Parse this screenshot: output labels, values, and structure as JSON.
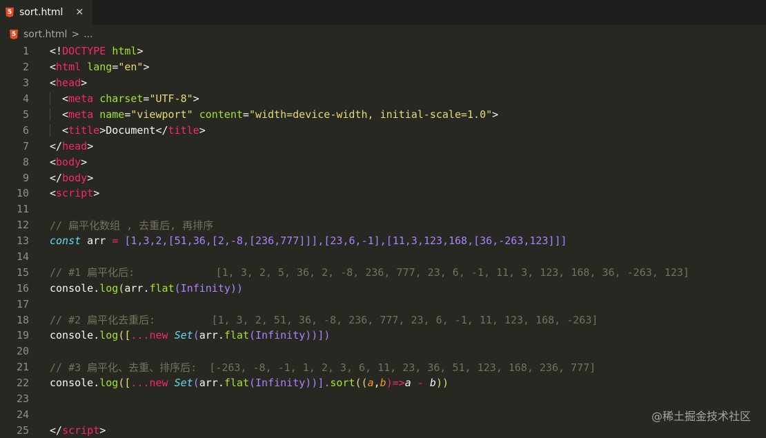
{
  "tab": {
    "label": "sort.html",
    "icon": "html5-icon",
    "close": "✕"
  },
  "breadcrumb": {
    "file": "sort.html",
    "sep": ">",
    "more": "..."
  },
  "lines": [
    "1",
    "2",
    "3",
    "4",
    "5",
    "6",
    "7",
    "8",
    "9",
    "10",
    "11",
    "12",
    "13",
    "14",
    "15",
    "16",
    "17",
    "18",
    "19",
    "20",
    "21",
    "22",
    "23",
    "24",
    "25"
  ],
  "code": {
    "l1": {
      "a": "<!",
      "b": "DOCTYPE",
      "c": " ",
      "d": "html",
      "e": ">"
    },
    "l2": {
      "a": "<",
      "b": "html",
      "c": " ",
      "d": "lang",
      "e": "=",
      "f": "\"en\"",
      "g": ">"
    },
    "l3": {
      "a": "<",
      "b": "head",
      "c": ">"
    },
    "l4": {
      "a": "<",
      "b": "meta",
      "c": " ",
      "d": "charset",
      "e": "=",
      "f": "\"UTF-8\"",
      "g": ">"
    },
    "l5": {
      "a": "<",
      "b": "meta",
      "c": " ",
      "d": "name",
      "e": "=",
      "f": "\"viewport\"",
      "g": " ",
      "h": "content",
      "i": "=",
      "j": "\"width=device-width, initial-scale=1.0\"",
      "k": ">"
    },
    "l6": {
      "a": "<",
      "b": "title",
      "c": ">Document</",
      "d": "title",
      "e": ">"
    },
    "l7": {
      "a": "</",
      "b": "head",
      "c": ">"
    },
    "l8": {
      "a": "<",
      "b": "body",
      "c": ">"
    },
    "l9": {
      "a": "</",
      "b": "body",
      "c": ">"
    },
    "l10": {
      "a": "<",
      "b": "script",
      "c": ">"
    },
    "l12": "// 扁平化数组 , 去重后, 再排序",
    "l13": {
      "kw": "const",
      "var": " arr ",
      "eq": "=",
      "sp": " ",
      "arr": "[1,3,2,[51,36,[2,-8,[236,777]]],[23,6,-1],[11,3,123,168,[36,-263,123]]]"
    },
    "l15": "// #1 扁平化后:             [1, 3, 2, 5, 36, 2, -8, 236, 777, 23, 6, -1, 11, 3, 123, 168, 36, -263, 123]",
    "l16": {
      "a": "console.",
      "b": "log",
      "c": "(",
      "d": "arr.",
      "e": "flat",
      "f": "(",
      "g": "Infinity",
      "h": "))"
    },
    "l18": "// #2 扁平化去重后:         [1, 3, 2, 51, 36, -8, 236, 777, 23, 6, -1, 11, 123, 168, -263]",
    "l19": {
      "a": "console.",
      "b": "log",
      "c": "([",
      "d": "...",
      "e": "new",
      "f": " ",
      "g": "Set",
      "h": "(",
      "i": "arr.",
      "j": "flat",
      "k": "(",
      "l": "Infinity",
      "m": "))])"
    },
    "l21": "// #3 扁平化、去重、排序后:  [-263, -8, -1, 1, 2, 3, 6, 11, 23, 36, 51, 123, 168, 236, 777]",
    "l22": {
      "a": "console.",
      "b": "log",
      "c": "([",
      "d": "...",
      "e": "new",
      "f": " ",
      "g": "Set",
      "h": "(",
      "i": "arr.",
      "j": "flat",
      "k": "(",
      "l": "Infinity",
      "m": "))].",
      "n": "sort",
      "o": "((",
      "p": "a",
      "q": ",",
      "r": "b",
      "s": ")=>",
      "t": "a",
      "u": " - ",
      "v": "b",
      "w": "))"
    },
    "l25": {
      "a": "</",
      "b": "script",
      "c": ">"
    }
  },
  "watermark": "@稀土掘金技术社区",
  "colors": {
    "background": "#272822",
    "tag": "#f92672",
    "attr": "#a6e22e",
    "string": "#e6db74",
    "comment": "#75715e",
    "keyword": "#66d9ef",
    "number": "#ae81ff"
  }
}
